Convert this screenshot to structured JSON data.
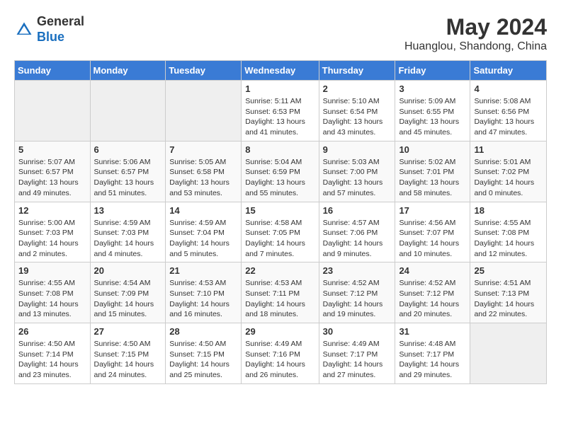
{
  "header": {
    "logo_general": "General",
    "logo_blue": "Blue",
    "month_year": "May 2024",
    "location": "Huanglou, Shandong, China"
  },
  "days_of_week": [
    "Sunday",
    "Monday",
    "Tuesday",
    "Wednesday",
    "Thursday",
    "Friday",
    "Saturday"
  ],
  "weeks": [
    [
      {
        "day": "",
        "info": ""
      },
      {
        "day": "",
        "info": ""
      },
      {
        "day": "",
        "info": ""
      },
      {
        "day": "1",
        "info": "Sunrise: 5:11 AM\nSunset: 6:53 PM\nDaylight: 13 hours\nand 41 minutes."
      },
      {
        "day": "2",
        "info": "Sunrise: 5:10 AM\nSunset: 6:54 PM\nDaylight: 13 hours\nand 43 minutes."
      },
      {
        "day": "3",
        "info": "Sunrise: 5:09 AM\nSunset: 6:55 PM\nDaylight: 13 hours\nand 45 minutes."
      },
      {
        "day": "4",
        "info": "Sunrise: 5:08 AM\nSunset: 6:56 PM\nDaylight: 13 hours\nand 47 minutes."
      }
    ],
    [
      {
        "day": "5",
        "info": "Sunrise: 5:07 AM\nSunset: 6:57 PM\nDaylight: 13 hours\nand 49 minutes."
      },
      {
        "day": "6",
        "info": "Sunrise: 5:06 AM\nSunset: 6:57 PM\nDaylight: 13 hours\nand 51 minutes."
      },
      {
        "day": "7",
        "info": "Sunrise: 5:05 AM\nSunset: 6:58 PM\nDaylight: 13 hours\nand 53 minutes."
      },
      {
        "day": "8",
        "info": "Sunrise: 5:04 AM\nSunset: 6:59 PM\nDaylight: 13 hours\nand 55 minutes."
      },
      {
        "day": "9",
        "info": "Sunrise: 5:03 AM\nSunset: 7:00 PM\nDaylight: 13 hours\nand 57 minutes."
      },
      {
        "day": "10",
        "info": "Sunrise: 5:02 AM\nSunset: 7:01 PM\nDaylight: 13 hours\nand 58 minutes."
      },
      {
        "day": "11",
        "info": "Sunrise: 5:01 AM\nSunset: 7:02 PM\nDaylight: 14 hours\nand 0 minutes."
      }
    ],
    [
      {
        "day": "12",
        "info": "Sunrise: 5:00 AM\nSunset: 7:03 PM\nDaylight: 14 hours\nand 2 minutes."
      },
      {
        "day": "13",
        "info": "Sunrise: 4:59 AM\nSunset: 7:03 PM\nDaylight: 14 hours\nand 4 minutes."
      },
      {
        "day": "14",
        "info": "Sunrise: 4:59 AM\nSunset: 7:04 PM\nDaylight: 14 hours\nand 5 minutes."
      },
      {
        "day": "15",
        "info": "Sunrise: 4:58 AM\nSunset: 7:05 PM\nDaylight: 14 hours\nand 7 minutes."
      },
      {
        "day": "16",
        "info": "Sunrise: 4:57 AM\nSunset: 7:06 PM\nDaylight: 14 hours\nand 9 minutes."
      },
      {
        "day": "17",
        "info": "Sunrise: 4:56 AM\nSunset: 7:07 PM\nDaylight: 14 hours\nand 10 minutes."
      },
      {
        "day": "18",
        "info": "Sunrise: 4:55 AM\nSunset: 7:08 PM\nDaylight: 14 hours\nand 12 minutes."
      }
    ],
    [
      {
        "day": "19",
        "info": "Sunrise: 4:55 AM\nSunset: 7:08 PM\nDaylight: 14 hours\nand 13 minutes."
      },
      {
        "day": "20",
        "info": "Sunrise: 4:54 AM\nSunset: 7:09 PM\nDaylight: 14 hours\nand 15 minutes."
      },
      {
        "day": "21",
        "info": "Sunrise: 4:53 AM\nSunset: 7:10 PM\nDaylight: 14 hours\nand 16 minutes."
      },
      {
        "day": "22",
        "info": "Sunrise: 4:53 AM\nSunset: 7:11 PM\nDaylight: 14 hours\nand 18 minutes."
      },
      {
        "day": "23",
        "info": "Sunrise: 4:52 AM\nSunset: 7:12 PM\nDaylight: 14 hours\nand 19 minutes."
      },
      {
        "day": "24",
        "info": "Sunrise: 4:52 AM\nSunset: 7:12 PM\nDaylight: 14 hours\nand 20 minutes."
      },
      {
        "day": "25",
        "info": "Sunrise: 4:51 AM\nSunset: 7:13 PM\nDaylight: 14 hours\nand 22 minutes."
      }
    ],
    [
      {
        "day": "26",
        "info": "Sunrise: 4:50 AM\nSunset: 7:14 PM\nDaylight: 14 hours\nand 23 minutes."
      },
      {
        "day": "27",
        "info": "Sunrise: 4:50 AM\nSunset: 7:15 PM\nDaylight: 14 hours\nand 24 minutes."
      },
      {
        "day": "28",
        "info": "Sunrise: 4:50 AM\nSunset: 7:15 PM\nDaylight: 14 hours\nand 25 minutes."
      },
      {
        "day": "29",
        "info": "Sunrise: 4:49 AM\nSunset: 7:16 PM\nDaylight: 14 hours\nand 26 minutes."
      },
      {
        "day": "30",
        "info": "Sunrise: 4:49 AM\nSunset: 7:17 PM\nDaylight: 14 hours\nand 27 minutes."
      },
      {
        "day": "31",
        "info": "Sunrise: 4:48 AM\nSunset: 7:17 PM\nDaylight: 14 hours\nand 29 minutes."
      },
      {
        "day": "",
        "info": ""
      }
    ]
  ]
}
